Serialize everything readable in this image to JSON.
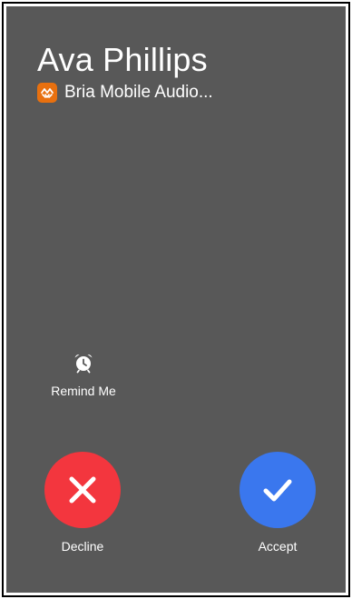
{
  "call": {
    "caller_name": "Ava Phillips",
    "app_name": "Bria Mobile Audio..."
  },
  "actions": {
    "remind": {
      "label": "Remind Me",
      "icon": "alarm-clock-icon"
    },
    "decline": {
      "label": "Decline",
      "icon": "x-icon",
      "color": "#f3363e"
    },
    "accept": {
      "label": "Accept",
      "icon": "checkmark-icon",
      "color": "#3a77ee"
    }
  },
  "colors": {
    "background": "#585858",
    "app_icon": "#e8700f",
    "text": "#ffffff"
  }
}
